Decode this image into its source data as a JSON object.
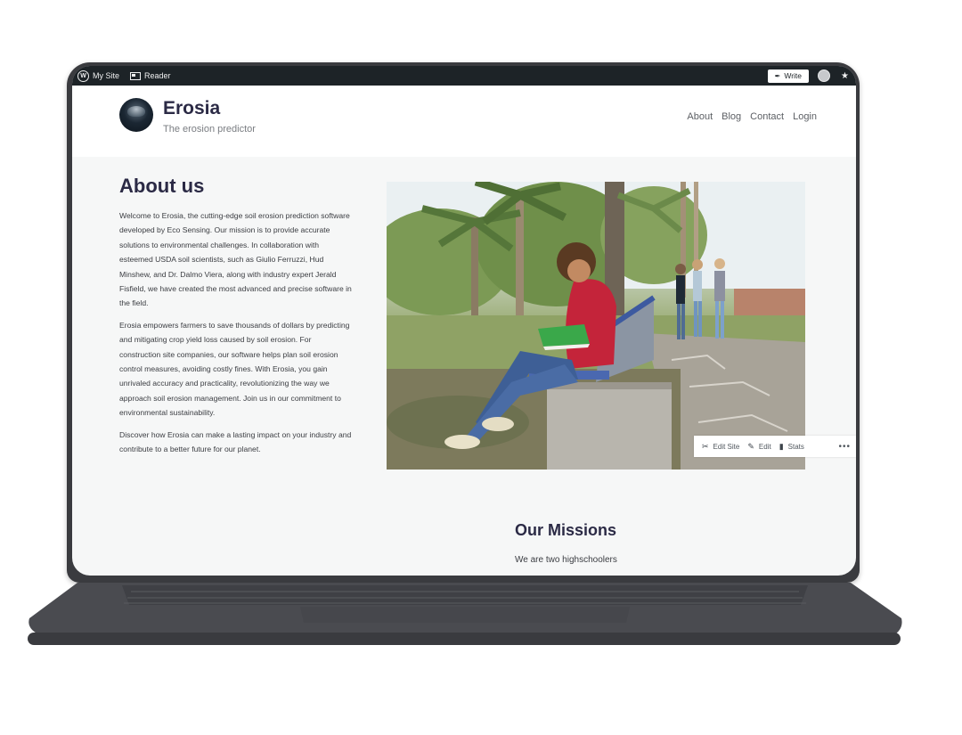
{
  "adminbar": {
    "my_site": "My Site",
    "reader": "Reader",
    "write": "Write"
  },
  "site": {
    "title": "Erosia",
    "tagline": "The erosion predictor",
    "nav": [
      "About",
      "Blog",
      "Contact",
      "Login"
    ]
  },
  "about": {
    "heading": "About us",
    "paragraphs": [
      "Welcome to Erosia, the cutting-edge soil erosion prediction software developed by Eco Sensing. Our mission is to provide accurate solutions to environmental challenges. In collaboration with esteemed USDA soil scientists, such as Giulio Ferruzzi, Hud Minshew, and Dr. Dalmo Viera, along with industry expert Jerald Fisfield, we have created the most advanced and precise software in the field.",
      "Erosia empowers farmers to save thousands of dollars by predicting and mitigating crop yield loss caused by soil erosion. For construction site companies, our software helps plan soil erosion control measures, avoiding costly fines. With Erosia, you gain unrivaled accuracy and practicality, revolutionizing the way we approach soil erosion management. Join us in our commitment to environmental sustainability.",
      "Discover how Erosia can make a lasting impact on your industry and contribute to a better future for our planet."
    ]
  },
  "toolbar": {
    "edit_site": "Edit Site",
    "edit": "Edit",
    "stats": "Stats",
    "more": "•••"
  },
  "missions": {
    "heading": "Our Missions",
    "text": "We are two highschoolers"
  },
  "colors": {
    "heading": "#2b2a45",
    "adminbar": "#1d2327",
    "laptop_body": "#3a3b3f"
  }
}
